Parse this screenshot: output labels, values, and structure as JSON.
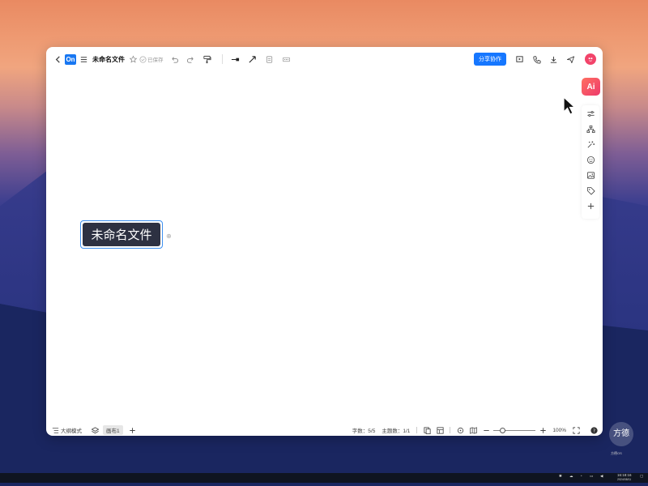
{
  "toolbar": {
    "app_logo": "On",
    "title": "未命名文件",
    "saved_status": "已保存",
    "share_label": "分享协作",
    "icons": [
      "back-icon",
      "menu-icon",
      "star-icon",
      "undo-icon",
      "redo-icon",
      "format-brush-icon",
      "line-style-icon",
      "arrow-icon",
      "frame-icon",
      "more-icon",
      "present-icon",
      "phone-icon",
      "download-icon",
      "send-icon"
    ]
  },
  "right_panel": {
    "ai_label": "Ai",
    "tools": [
      "settings-sliders-icon",
      "structure-icon",
      "magic-icon",
      "emoji-icon",
      "image-icon",
      "tag-icon",
      "plus-icon"
    ]
  },
  "canvas": {
    "node_text": "未命名文件"
  },
  "statusbar": {
    "outline_mode": "大纲模式",
    "canvas_tab": "画布1",
    "word_count": "字数：5/5",
    "topic_count": "主题数：1/1",
    "zoom": "100%"
  },
  "watermark": {
    "seal_text": "方德",
    "sub_text": "方德OS"
  },
  "taskbar": {
    "time": "16:18:16",
    "date": "2024/08/11"
  }
}
